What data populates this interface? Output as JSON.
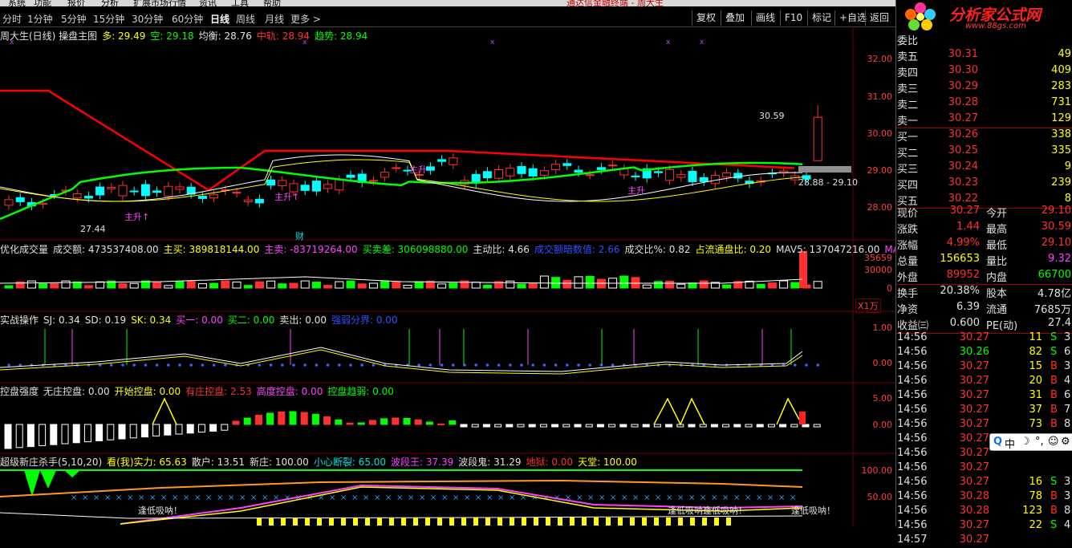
{
  "menubar": {
    "items": [
      "系统",
      "功能",
      "报价",
      "分析",
      "扩展市场行情",
      "资讯",
      "工具",
      "帮助"
    ],
    "center_title": "通达信金融终端 - 周大生"
  },
  "periodbar": {
    "periods": [
      "分时",
      "1分钟",
      "5分钟",
      "15分钟",
      "30分钟",
      "60分钟",
      "日线",
      "周线",
      "月线",
      "更多 >"
    ],
    "active": "日线",
    "buttons": [
      "复权",
      "叠加",
      "画线",
      "F10",
      "标记",
      "+自选",
      "返回"
    ]
  },
  "main_chart": {
    "title": "周大生(日线) 操盘主图",
    "items": [
      {
        "label": "多: 29.49",
        "color": "#ffff00"
      },
      {
        "label": "空: 29.18",
        "color": "#00ff00"
      },
      {
        "label": "均衡: 28.76",
        "color": "#e0e0e0"
      },
      {
        "label": "中轨: 28.94",
        "color": "#ff3030"
      },
      {
        "label": "趋势: 28.94",
        "color": "#00ff00"
      }
    ],
    "y_ticks": [
      "32.00",
      "31.00",
      "30.00",
      "29.00",
      "28.00"
    ],
    "annotations": {
      "high": "30.59",
      "low": "27.44",
      "range": "28.88 - 29.10",
      "up1": "主升↑",
      "up2": "主升↑",
      "up3": "主升",
      "up4": "主升",
      "cai": "财"
    }
  },
  "volume_panel": {
    "title": "优化成交量",
    "items": [
      {
        "label": "成交额: 473537408.00",
        "color": "#e0e0e0"
      },
      {
        "label": "主买: 389818144.00",
        "color": "#ffff00"
      },
      {
        "label": "主卖: -83719264.00",
        "color": "#ff40ff"
      },
      {
        "label": "买卖差: 306098880.00",
        "color": "#00ff00"
      },
      {
        "label": "主动比: 4.66",
        "color": "#e0e0e0"
      },
      {
        "label": "成交额暗数值: 2.66",
        "color": "#3050ff"
      },
      {
        "label": "成交比%: 0.82",
        "color": "#e0e0e0"
      },
      {
        "label": "占流通盘比: 0.20",
        "color": "#ffff00"
      },
      {
        "label": "MAV5: 137047216.00",
        "color": "#e0e0e0"
      },
      {
        "label": "MA",
        "color": "#ff40ff"
      }
    ],
    "y_ticks": [
      "35659",
      "30000",
      "0"
    ],
    "unit": "X1万"
  },
  "trade_panel": {
    "title": "实战操作",
    "items": [
      {
        "label": "SJ: 0.34",
        "color": "#e0e0e0"
      },
      {
        "label": "SD: 0.19",
        "color": "#e0e0e0"
      },
      {
        "label": "SK: 0.34",
        "color": "#ffff00"
      },
      {
        "label": "买一: 0.00",
        "color": "#ff40ff"
      },
      {
        "label": "买二: 0.00",
        "color": "#00ff00"
      },
      {
        "label": "卖出: 0.00",
        "color": "#e0e0e0"
      },
      {
        "label": "强弱分界: 0.00",
        "color": "#3050ff"
      }
    ],
    "y_ticks": [
      "1.00",
      "0.00"
    ]
  },
  "control_panel": {
    "title": "控盘强度",
    "items": [
      {
        "label": "无庄控盘: 0.00",
        "color": "#e0e0e0"
      },
      {
        "label": "开始控盘: 0.00",
        "color": "#ffff00"
      },
      {
        "label": "有庄控盘: 2.53",
        "color": "#ff3030"
      },
      {
        "label": "高度控盘: 0.00",
        "color": "#ff40ff"
      },
      {
        "label": "控盘趋弱: 0.00",
        "color": "#00ff00"
      }
    ],
    "y_ticks": [
      "5.00",
      "0.00"
    ]
  },
  "killer_panel": {
    "title": "超级新庄杀手(5,10,20)",
    "items": [
      {
        "label": "看(我)实力: 65.63",
        "color": "#ffff00"
      },
      {
        "label": "散户: 13.51",
        "color": "#e0e0e0"
      },
      {
        "label": "新庄: 100.00",
        "color": "#e0e0e0"
      },
      {
        "label": "小心断裂: 65.00",
        "color": "#00e0e0"
      },
      {
        "label": "波段王: 37.39",
        "color": "#ff40ff"
      },
      {
        "label": "波段鬼: 31.29",
        "color": "#e0e0e0"
      },
      {
        "label": "地狱: 0.00",
        "color": "#ff3030"
      },
      {
        "label": "天堂: 100.00",
        "color": "#ffff00"
      }
    ],
    "y_ticks": [
      "100.00",
      "50.00"
    ],
    "signal_text": "逢低吸呐！"
  },
  "quote": {
    "logo_text": "分析家公式网",
    "logo_url_text": "www.88gs.com",
    "header": "委比",
    "asks": [
      {
        "label": "卖五",
        "price": "30.31",
        "vol": "49"
      },
      {
        "label": "卖四",
        "price": "30.30",
        "vol": "409"
      },
      {
        "label": "卖三",
        "price": "30.29",
        "vol": "283"
      },
      {
        "label": "卖二",
        "price": "30.28",
        "vol": "731"
      },
      {
        "label": "卖一",
        "price": "30.27",
        "vol": "129"
      }
    ],
    "bids": [
      {
        "label": "买一",
        "price": "30.26",
        "vol": "338"
      },
      {
        "label": "买二",
        "price": "30.25",
        "vol": "335"
      },
      {
        "label": "买三",
        "price": "30.24",
        "vol": "9"
      },
      {
        "label": "买四",
        "price": "30.23",
        "vol": "239"
      },
      {
        "label": "买五",
        "price": "30.22",
        "vol": "8"
      }
    ],
    "stats": [
      {
        "l1": "现价",
        "v1": "30.27",
        "c1": "#ff3030",
        "l2": "今开",
        "v2": "29.10",
        "c2": "#ff3030"
      },
      {
        "l1": "涨跌",
        "v1": "1.44",
        "c1": "#ff3030",
        "l2": "最高",
        "v2": "30.59",
        "c2": "#ff3030"
      },
      {
        "l1": "涨幅",
        "v1": "4.99%",
        "c1": "#ff3030",
        "l2": "最低",
        "v2": "29.10",
        "c2": "#ff3030"
      },
      {
        "l1": "总量",
        "v1": "156653",
        "c1": "#ffff00",
        "l2": "量比",
        "v2": "9.32",
        "c2": "#ff40ff"
      },
      {
        "l1": "外盘",
        "v1": "89952",
        "c1": "#ff3030",
        "l2": "内盘",
        "v2": "66700",
        "c2": "#00ff00"
      },
      {
        "l1": "换手",
        "v1": "20.38%",
        "c1": "#e0e0e0",
        "l2": "股本",
        "v2": "4.78亿",
        "c2": "#e0e0e0"
      },
      {
        "l1": "净资",
        "v1": "6.39",
        "c1": "#e0e0e0",
        "l2": "流通",
        "v2": "7685万",
        "c2": "#e0e0e0"
      },
      {
        "l1": "收益㈢",
        "v1": "0.600",
        "c1": "#e0e0e0",
        "l2": "PE(动)",
        "v2": "27.4",
        "c2": "#e0e0e0"
      }
    ],
    "ticks": [
      {
        "time": "14:56",
        "price": "30.27",
        "vol": "11",
        "bs": "S",
        "n": "3"
      },
      {
        "time": "14:56",
        "price": "30.26",
        "vol": "82",
        "bs": "S",
        "n": "6"
      },
      {
        "time": "14:56",
        "price": "30.27",
        "vol": "15",
        "bs": "B",
        "n": "3"
      },
      {
        "time": "14:56",
        "price": "30.27",
        "vol": "20",
        "bs": "B",
        "n": "4"
      },
      {
        "time": "14:56",
        "price": "30.27",
        "vol": "31",
        "bs": "B",
        "n": "6"
      },
      {
        "time": "14:56",
        "price": "30.27",
        "vol": "37",
        "bs": "B",
        "n": "7"
      },
      {
        "time": "14:56",
        "price": "30.27",
        "vol": "73",
        "bs": "B",
        "n": "8"
      },
      {
        "time": "14:56",
        "price": "30.27",
        "vol": "",
        "bs": "",
        "n": ""
      },
      {
        "time": "14:56",
        "price": "30.27",
        "vol": "",
        "bs": "",
        "n": ""
      },
      {
        "time": "14:56",
        "price": "30.27",
        "vol": "",
        "bs": "",
        "n": ""
      },
      {
        "time": "14:56",
        "price": "30.27",
        "vol": "16",
        "bs": "S",
        "n": "3"
      },
      {
        "time": "14:56",
        "price": "30.28",
        "vol": "78",
        "bs": "B",
        "n": "3"
      },
      {
        "time": "14:56",
        "price": "30.28",
        "vol": "123",
        "bs": "B",
        "n": "8"
      },
      {
        "time": "14:56",
        "price": "30.27",
        "vol": "22",
        "bs": "S",
        "n": "4"
      },
      {
        "time": "14:57",
        "price": "30.27",
        "vol": "",
        "bs": "",
        "n": ""
      }
    ],
    "ime": [
      "Q",
      "中",
      "☽",
      "°,",
      "☺",
      "⚙"
    ]
  },
  "colors": {
    "up": "#ff3030",
    "down": "#00ffff",
    "ma_red": "#ff0000",
    "ma_green": "#00ff00",
    "bg": "#000000"
  }
}
